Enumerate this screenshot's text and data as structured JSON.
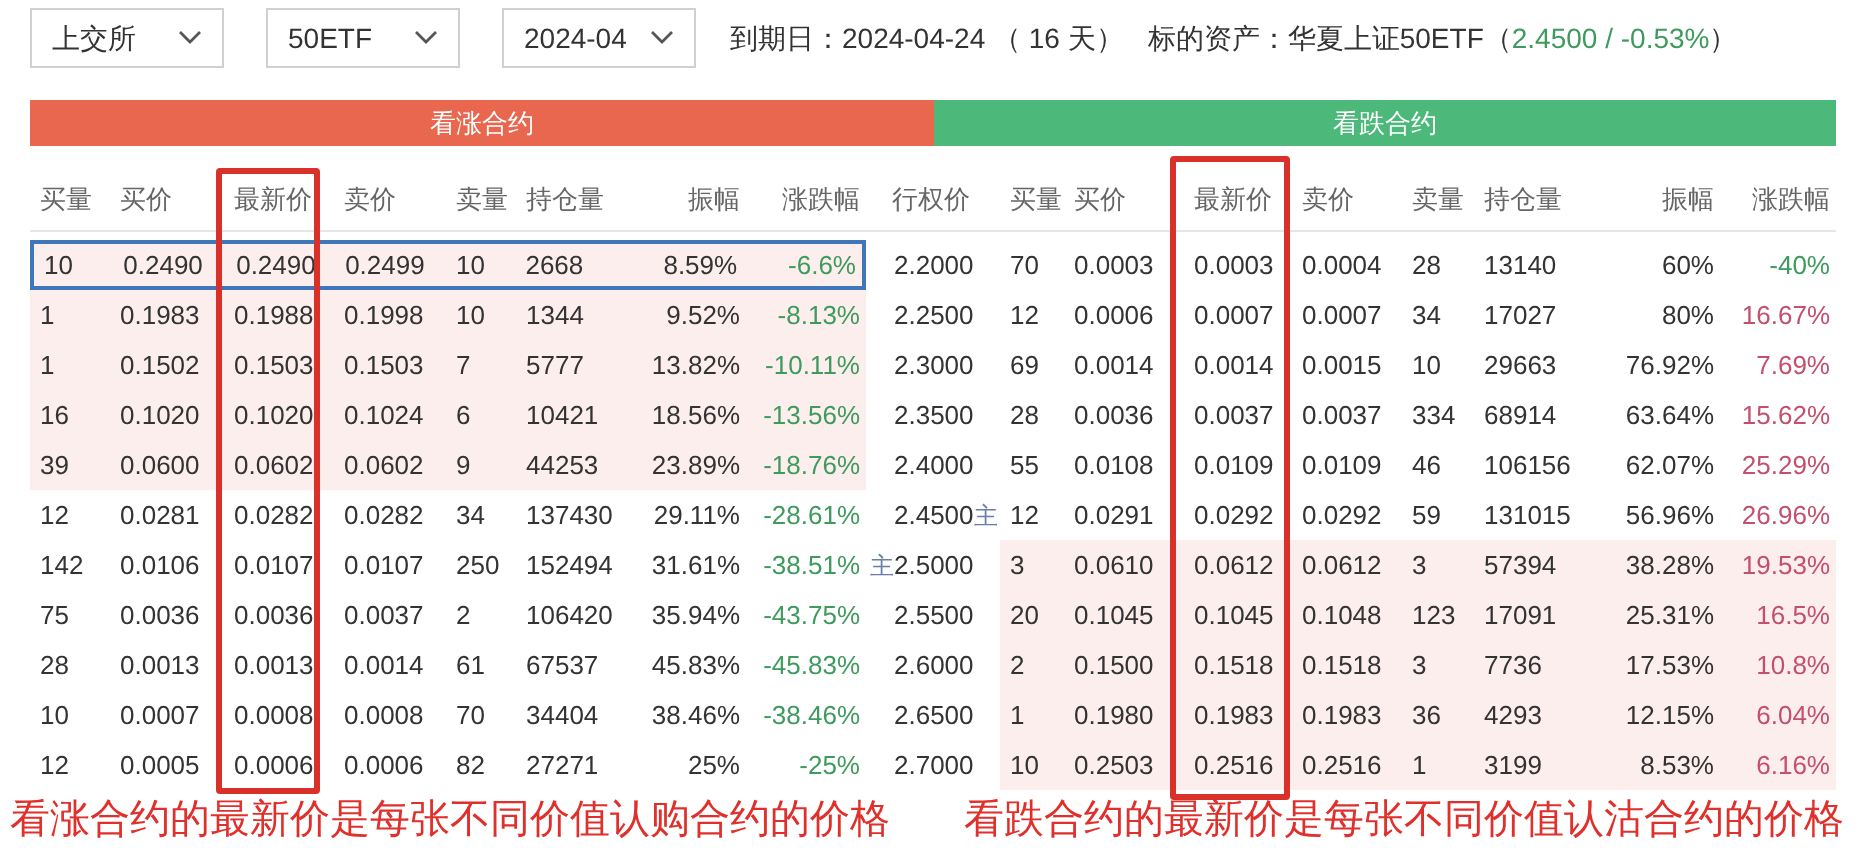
{
  "filters": [
    {
      "value": "上交所"
    },
    {
      "value": "50ETF"
    },
    {
      "value": "2024-04"
    }
  ],
  "expiry": "到期日：2024-04-24 （ 16 天）",
  "underlying": {
    "label": "标的资产：华夏上证50ETF",
    "open": "（",
    "quote": "2.4500 / -0.53%",
    "close": "）"
  },
  "sections": [
    {
      "title": "看涨合约",
      "color": "#e9664f"
    },
    {
      "title": "看跌合约",
      "color": "#4cb87a"
    }
  ],
  "call_columns": [
    "买量",
    "买价",
    "最新价",
    "卖价",
    "卖量",
    "持仓量",
    "振幅",
    "涨跌幅"
  ],
  "strike_column": "行权价",
  "put_columns": [
    "买量",
    "买价",
    "最新价",
    "卖价",
    "卖量",
    "持仓量",
    "振幅",
    "涨跌幅"
  ],
  "rows": [
    {
      "call": {
        "cells": [
          "10",
          "0.2490",
          "0.2490",
          "0.2499",
          "10",
          "2668",
          "8.59%",
          "-6.6%"
        ],
        "color": "#3f9a5e",
        "in_the_money": true,
        "selected": true
      },
      "strike": {
        "price": "2.2000"
      },
      "put": {
        "cells": [
          "70",
          "0.0003",
          "0.0003",
          "0.0004",
          "28",
          "13140",
          "60%",
          "-40%"
        ],
        "color": "#3f9a5e",
        "in_the_money": false,
        "selected": false
      }
    },
    {
      "call": {
        "cells": [
          "1",
          "0.1983",
          "0.1988",
          "0.1998",
          "10",
          "1344",
          "9.52%",
          "-8.13%"
        ],
        "color": "#3f9a5e",
        "in_the_money": true,
        "selected": false
      },
      "strike": {
        "price": "2.2500"
      },
      "put": {
        "cells": [
          "12",
          "0.0006",
          "0.0007",
          "0.0007",
          "34",
          "17027",
          "80%",
          "16.67%"
        ],
        "color": "#c2506e",
        "in_the_money": false,
        "selected": false
      }
    },
    {
      "call": {
        "cells": [
          "1",
          "0.1502",
          "0.1503",
          "0.1503",
          "7",
          "5777",
          "13.82%",
          "-10.11%"
        ],
        "color": "#3f9a5e",
        "in_the_money": true,
        "selected": false
      },
      "strike": {
        "price": "2.3000"
      },
      "put": {
        "cells": [
          "69",
          "0.0014",
          "0.0014",
          "0.0015",
          "10",
          "29663",
          "76.92%",
          "7.69%"
        ],
        "color": "#c2506e",
        "in_the_money": false,
        "selected": false
      }
    },
    {
      "call": {
        "cells": [
          "16",
          "0.1020",
          "0.1020",
          "0.1024",
          "6",
          "10421",
          "18.56%",
          "-13.56%"
        ],
        "color": "#3f9a5e",
        "in_the_money": true,
        "selected": false
      },
      "strike": {
        "price": "2.3500"
      },
      "put": {
        "cells": [
          "28",
          "0.0036",
          "0.0037",
          "0.0037",
          "334",
          "68914",
          "63.64%",
          "15.62%"
        ],
        "color": "#c2506e",
        "in_the_money": false,
        "selected": false
      }
    },
    {
      "call": {
        "cells": [
          "39",
          "0.0600",
          "0.0602",
          "0.0602",
          "9",
          "44253",
          "23.89%",
          "-18.76%"
        ],
        "color": "#3f9a5e",
        "in_the_money": true,
        "selected": false
      },
      "strike": {
        "price": "2.4000"
      },
      "put": {
        "cells": [
          "55",
          "0.0108",
          "0.0109",
          "0.0109",
          "46",
          "106156",
          "62.07%",
          "25.29%"
        ],
        "color": "#c2506e",
        "in_the_money": false,
        "selected": false
      }
    },
    {
      "call": {
        "cells": [
          "12",
          "0.0281",
          "0.0282",
          "0.0282",
          "34",
          "137430",
          "29.11%",
          "-28.61%"
        ],
        "color": "#3f9a5e",
        "in_the_money": false,
        "selected": false
      },
      "strike": {
        "price": "2.4500",
        "mark_after": "主"
      },
      "put": {
        "cells": [
          "12",
          "0.0291",
          "0.0292",
          "0.0292",
          "59",
          "131015",
          "56.96%",
          "26.96%"
        ],
        "color": "#c2506e",
        "in_the_money": false,
        "selected": false
      }
    },
    {
      "call": {
        "cells": [
          "142",
          "0.0106",
          "0.0107",
          "0.0107",
          "250",
          "152494",
          "31.61%",
          "-38.51%"
        ],
        "color": "#3f9a5e",
        "in_the_money": false,
        "selected": false
      },
      "strike": {
        "price": "2.5000",
        "mark_before": "主"
      },
      "put": {
        "cells": [
          "3",
          "0.0610",
          "0.0612",
          "0.0612",
          "3",
          "57394",
          "38.28%",
          "19.53%"
        ],
        "color": "#c2506e",
        "in_the_money": true,
        "selected": false
      }
    },
    {
      "call": {
        "cells": [
          "75",
          "0.0036",
          "0.0036",
          "0.0037",
          "2",
          "106420",
          "35.94%",
          "-43.75%"
        ],
        "color": "#3f9a5e",
        "in_the_money": false,
        "selected": false
      },
      "strike": {
        "price": "2.5500"
      },
      "put": {
        "cells": [
          "20",
          "0.1045",
          "0.1045",
          "0.1048",
          "123",
          "17091",
          "25.31%",
          "16.5%"
        ],
        "color": "#c2506e",
        "in_the_money": true,
        "selected": false
      }
    },
    {
      "call": {
        "cells": [
          "28",
          "0.0013",
          "0.0013",
          "0.0014",
          "61",
          "67537",
          "45.83%",
          "-45.83%"
        ],
        "color": "#3f9a5e",
        "in_the_money": false,
        "selected": false
      },
      "strike": {
        "price": "2.6000"
      },
      "put": {
        "cells": [
          "2",
          "0.1500",
          "0.1518",
          "0.1518",
          "3",
          "7736",
          "17.53%",
          "10.8%"
        ],
        "color": "#c2506e",
        "in_the_money": true,
        "selected": false
      }
    },
    {
      "call": {
        "cells": [
          "10",
          "0.0007",
          "0.0008",
          "0.0008",
          "70",
          "34404",
          "38.46%",
          "-38.46%"
        ],
        "color": "#3f9a5e",
        "in_the_money": false,
        "selected": false
      },
      "strike": {
        "price": "2.6500"
      },
      "put": {
        "cells": [
          "1",
          "0.1980",
          "0.1983",
          "0.1983",
          "36",
          "4293",
          "12.15%",
          "6.04%"
        ],
        "color": "#c2506e",
        "in_the_money": true,
        "selected": false
      }
    },
    {
      "call": {
        "cells": [
          "12",
          "0.0005",
          "0.0006",
          "0.0006",
          "82",
          "27271",
          "25%",
          "-25%"
        ],
        "color": "#3f9a5e",
        "in_the_money": false,
        "selected": false
      },
      "strike": {
        "price": "2.7000"
      },
      "put": {
        "cells": [
          "10",
          "0.2503",
          "0.2516",
          "0.2516",
          "1",
          "3199",
          "8.53%",
          "6.16%"
        ],
        "color": "#c2506e",
        "in_the_money": true,
        "selected": false
      }
    }
  ],
  "annotations": [
    "看涨合约的最新价是每张不同价值认购合约的价格",
    "看跌合约的最新价是每张不同价值认沽合约的价格"
  ]
}
